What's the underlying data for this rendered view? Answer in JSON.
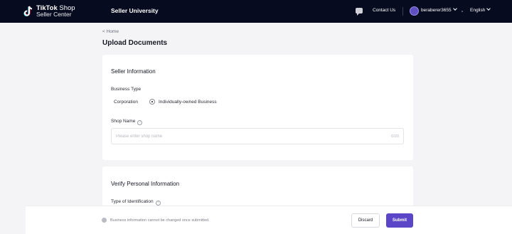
{
  "topbar": {
    "logo_brand": "TikTok",
    "logo_shop": "Shop",
    "logo_subtitle": "Seller Center",
    "title": "Seller University",
    "contact": "Contact Us",
    "username": "beraberer3655",
    "language": "English",
    "bg_color": "#060b1f"
  },
  "breadcrumb": "< Home",
  "page_title": "Upload Documents",
  "seller_info": {
    "title": "Seller Information",
    "business_type_label": "Business Type",
    "options": [
      "Corporation",
      "Individually-owned Business"
    ],
    "selected": "Individually-owned Business",
    "shop_name_label": "Shop Name",
    "shop_name_placeholder": "Please enter shop name",
    "shop_name_value": "",
    "counter": "0/20"
  },
  "verify_info": {
    "title": "Verify Personal Information",
    "id_type_label": "Type of Identification"
  },
  "bottom_bar": {
    "notice": "Business information cannot be changed once submitted.",
    "discard": "Discard",
    "submit": "Submit",
    "accent_color": "#5b46c8"
  }
}
